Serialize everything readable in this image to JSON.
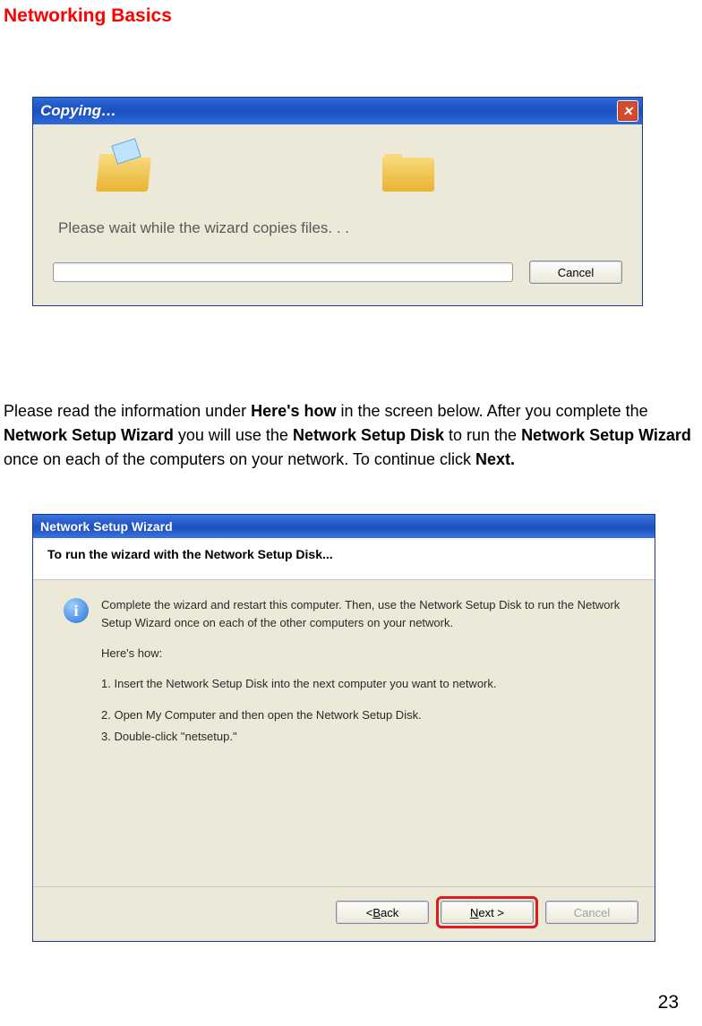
{
  "page": {
    "heading": "Networking Basics",
    "number": "23"
  },
  "copying_dialog": {
    "title": "Copying…",
    "message": "Please wait while the wizard copies files. . .",
    "cancel_label": "Cancel",
    "close_symbol": "✕"
  },
  "paragraph": {
    "t1": "Please read the information under ",
    "b1": "Here's how",
    "t2": " in the screen below.  After you complete the ",
    "b2": "Network Setup Wizard",
    "t3": " you will use the ",
    "b3": "Network Setup Disk",
    "t4": " to run the ",
    "b4": "Network Setup Wizard",
    "t5": " once on each of the computers on your network.  To continue click ",
    "b5": "Next."
  },
  "wizard_dialog": {
    "title": "Network Setup Wizard",
    "header": "To run the wizard with the Network Setup Disk...",
    "info_char": "i",
    "intro": "Complete the wizard and restart this computer. Then, use the Network Setup Disk to run the Network Setup Wizard once on each of the other computers on your network.",
    "heres_how": "Here's how:",
    "step1": "1.  Insert the Network Setup Disk into the next computer you want to network.",
    "step2": "2.  Open My Computer and then open the Network Setup Disk.",
    "step3": "3.  Double-click \"netsetup.\"",
    "back_prefix": "< ",
    "back_u": "B",
    "back_rest": "ack",
    "next_u": "N",
    "next_rest": "ext >",
    "cancel_label": "Cancel"
  }
}
